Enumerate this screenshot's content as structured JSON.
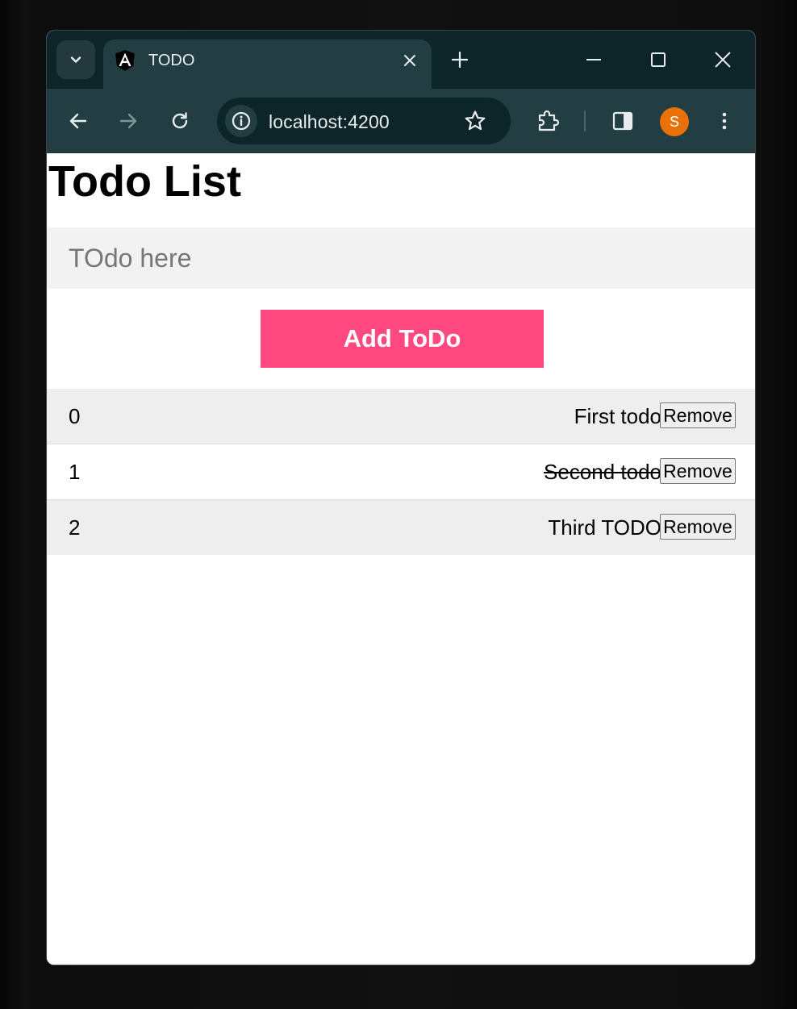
{
  "browser": {
    "tab": {
      "title": "TODO",
      "favicon": "angular-logo-icon"
    },
    "address_bar": {
      "url": "localhost:4200"
    },
    "profile": {
      "initial": "S",
      "color": "#e8710a"
    },
    "theme": {
      "frame": "#0d2428",
      "toolbar": "#223e43"
    }
  },
  "page": {
    "title": "Todo List",
    "input": {
      "placeholder": "TOdo here",
      "value": ""
    },
    "add_button_label": "Add ToDo",
    "accent_color": "#ff4780",
    "todos": [
      {
        "index": "0",
        "text": "First todo",
        "completed": false,
        "remove_label": "Remove"
      },
      {
        "index": "1",
        "text": "Second todo",
        "completed": true,
        "remove_label": "Remove"
      },
      {
        "index": "2",
        "text": "Third TODO",
        "completed": false,
        "remove_label": "Remove"
      }
    ]
  }
}
